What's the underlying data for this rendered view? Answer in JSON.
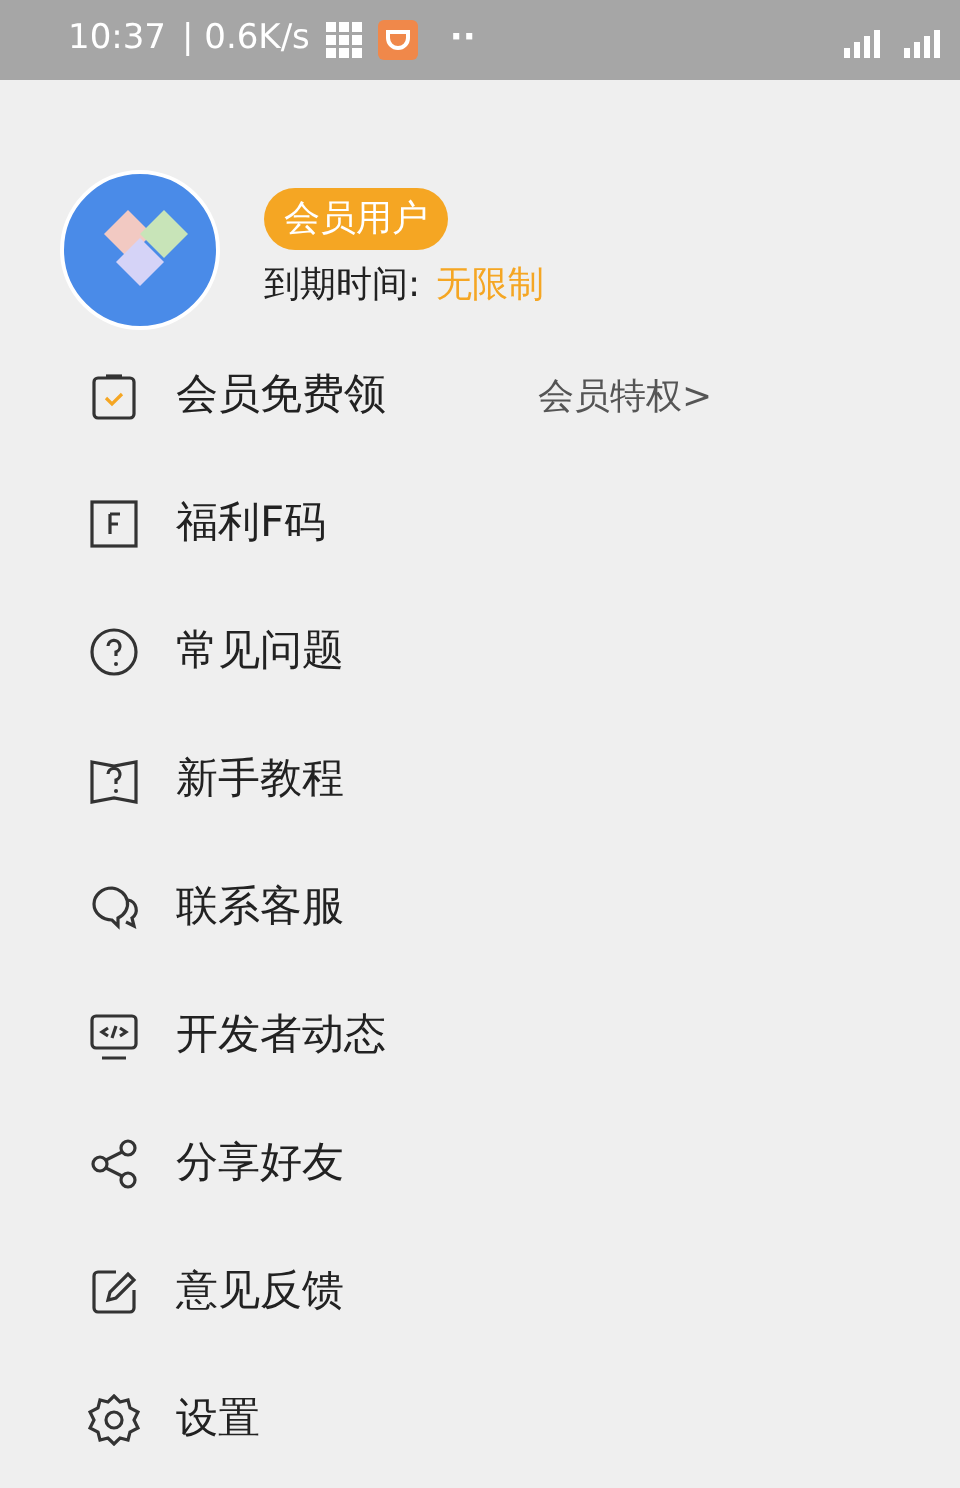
{
  "status_bar": {
    "time": "10:37",
    "speed": "| 0.6K/s",
    "more": "··"
  },
  "profile": {
    "badge": "会员用户",
    "expiry_label": "到期时间:",
    "expiry_value": "无限制"
  },
  "menu": [
    {
      "label": "会员免费领",
      "extra": "会员特权>"
    },
    {
      "label": "福利F码"
    },
    {
      "label": "常见问题"
    },
    {
      "label": "新手教程"
    },
    {
      "label": "联系客服"
    },
    {
      "label": "开发者动态"
    },
    {
      "label": "分享好友"
    },
    {
      "label": "意见反馈"
    },
    {
      "label": "设置"
    }
  ]
}
